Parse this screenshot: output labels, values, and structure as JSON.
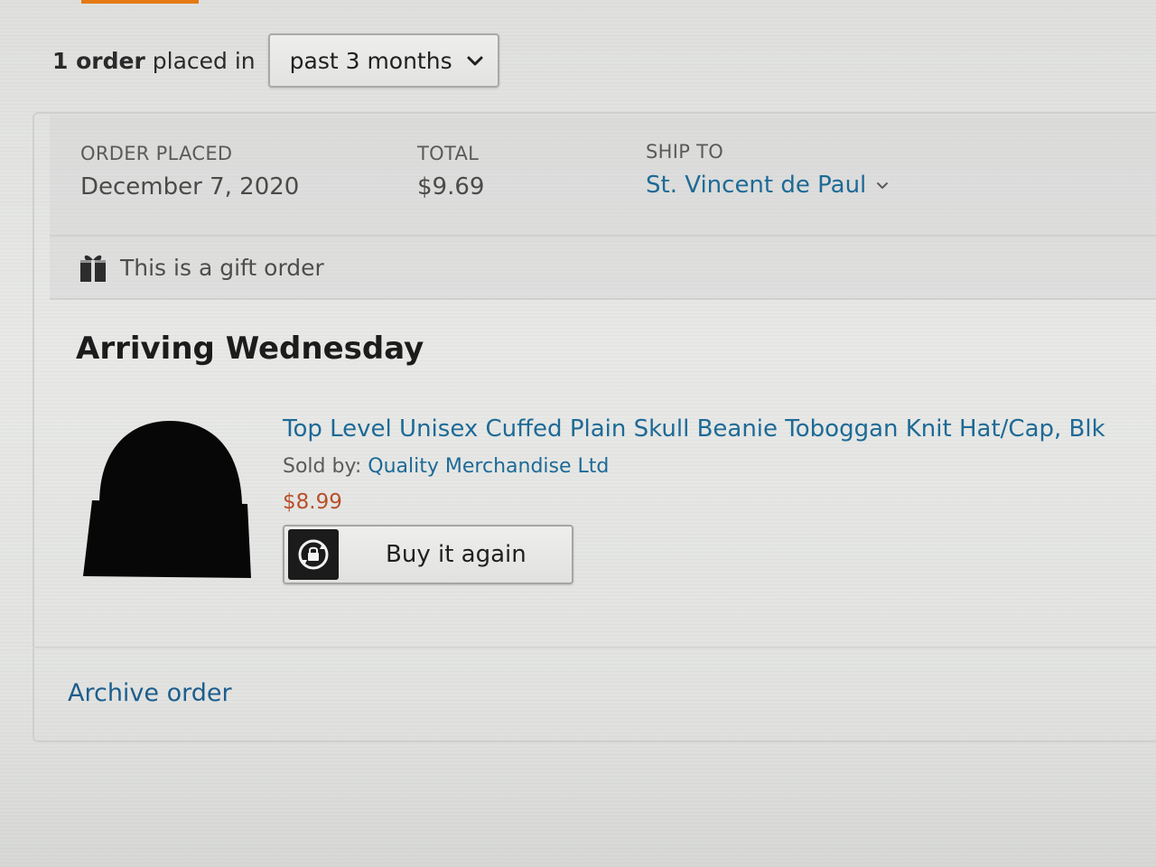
{
  "filter": {
    "count": "1 order",
    "suffix": "placed in",
    "selected": "past 3 months"
  },
  "order": {
    "placed_label": "ORDER PLACED",
    "placed_value": "December 7, 2020",
    "total_label": "TOTAL",
    "total_value": "$9.69",
    "ship_label": "SHIP TO",
    "ship_value": "St. Vincent de Paul",
    "gift_text": "This is a gift order",
    "status": "Arriving Wednesday",
    "archive_label": "Archive order"
  },
  "item": {
    "title": "Top Level Unisex Cuffed Plain Skull Beanie Toboggan Knit Hat/Cap, Blk",
    "sold_by_label": "Sold by:",
    "seller": "Quality Merchandise Ltd",
    "price": "$8.99",
    "buy_again_label": "Buy it again",
    "image_icon": "beanie-hat"
  },
  "colors": {
    "link": "#1d6a96",
    "price": "#b8502a",
    "accent": "#e47911"
  }
}
